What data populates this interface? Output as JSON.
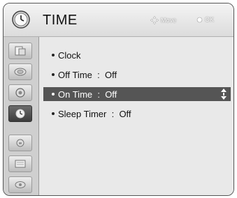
{
  "header": {
    "title": "TIME",
    "hint_move": "Move",
    "hint_ok": "OK"
  },
  "menu": {
    "items": [
      {
        "label": "Clock",
        "value": ""
      },
      {
        "label": "Off Time",
        "value": "Off"
      },
      {
        "label": "On Time",
        "value": "Off",
        "selected": true
      },
      {
        "label": "Sleep Timer",
        "value": "Off"
      }
    ]
  },
  "sidebar": {
    "items": [
      {
        "icon": "picture-icon"
      },
      {
        "icon": "audio-icon"
      },
      {
        "icon": "option-icon"
      },
      {
        "icon": "time-icon",
        "active": true
      },
      {
        "icon": "lock-icon"
      },
      {
        "icon": "screen-icon"
      },
      {
        "icon": "input-icon"
      }
    ]
  },
  "colors": {
    "selection": "#555555",
    "panel": "#e9e9e9",
    "sidebar": "#cfcfcf"
  }
}
